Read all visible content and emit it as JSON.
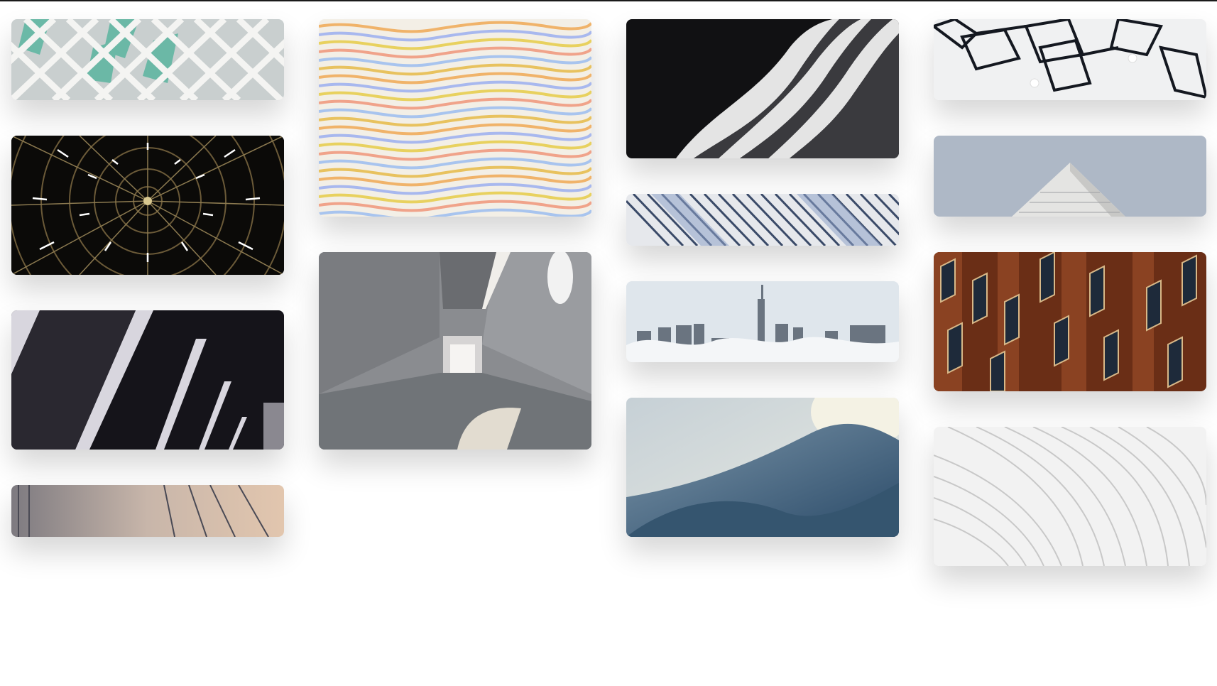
{
  "gallery": {
    "columns": [
      {
        "photos": [
          {
            "subject": "diamond-lattice-facade"
          },
          {
            "subject": "radial-dome-ceiling"
          },
          {
            "subject": "dark-diagonal-beams"
          },
          {
            "subject": "foggy-vertical-lines"
          }
        ]
      },
      {
        "photos": [
          {
            "subject": "wavy-pastel-stripes"
          },
          {
            "subject": "concrete-corridor"
          }
        ]
      },
      {
        "photos": [
          {
            "subject": "curved-white-building"
          },
          {
            "subject": "diagonal-stripes"
          },
          {
            "subject": "city-above-clouds"
          },
          {
            "subject": "abstract-curves"
          }
        ]
      },
      {
        "photos": [
          {
            "subject": "cube-lamps"
          },
          {
            "subject": "building-corner-sky"
          },
          {
            "subject": "wooden-window-facade"
          },
          {
            "subject": "white-ribbed-structure"
          }
        ]
      }
    ],
    "colors": {
      "topbar": "#1a1a1a",
      "background": "#ffffff"
    }
  }
}
